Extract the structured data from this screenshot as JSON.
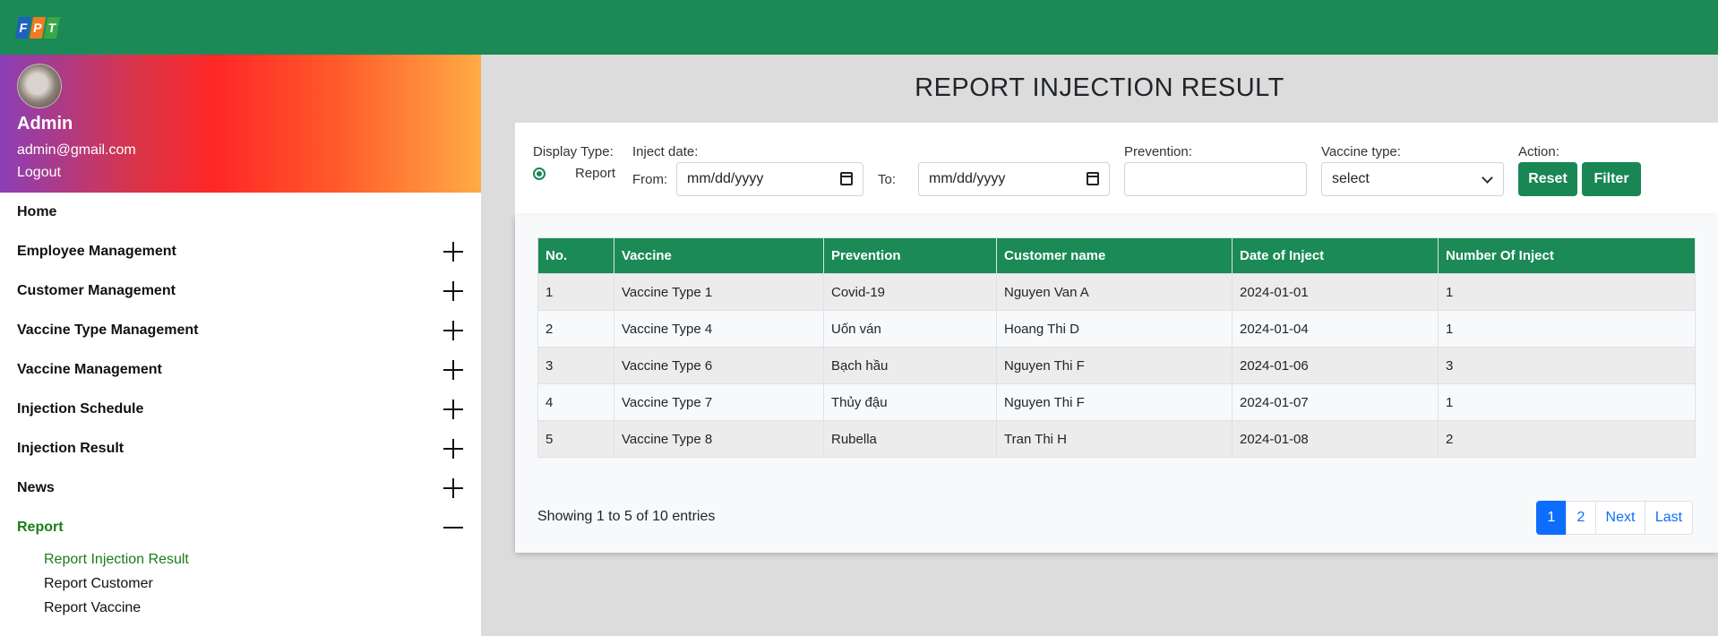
{
  "logo": {
    "letters": [
      "F",
      "P",
      "T"
    ]
  },
  "profile": {
    "name": "Admin",
    "email": "admin@gmail.com",
    "logout": "Logout"
  },
  "menu": {
    "home": "Home",
    "items": [
      {
        "label": "Employee Management",
        "toggle": "plus"
      },
      {
        "label": "Customer Management",
        "toggle": "plus"
      },
      {
        "label": "Vaccine Type Management",
        "toggle": "plus"
      },
      {
        "label": "Vaccine Management",
        "toggle": "plus"
      },
      {
        "label": "Injection Schedule",
        "toggle": "plus"
      },
      {
        "label": "Injection Result",
        "toggle": "plus"
      },
      {
        "label": "News",
        "toggle": "plus"
      },
      {
        "label": "Report",
        "toggle": "minus"
      }
    ],
    "report_sub": [
      "Report Injection Result",
      "Report Customer",
      "Report Vaccine"
    ]
  },
  "page_title": "REPORT INJECTION RESULT",
  "filters": {
    "display_type_label": "Display Type:",
    "display_type_option": "Report",
    "inject_date_label": "Inject date:",
    "from_label": "From:",
    "to_label": "To:",
    "from_placeholder": "mm/dd/yyyy",
    "to_placeholder": "mm/dd/yyyy",
    "prevention_label": "Prevention:",
    "prevention_value": "",
    "vaccine_type_label": "Vaccine type:",
    "vaccine_type_selected": "select",
    "action_label": "Action:",
    "reset": "Reset",
    "filter": "Filter"
  },
  "table": {
    "headers": [
      "No.",
      "Vaccine",
      "Prevention",
      "Customer name",
      "Date of Inject",
      "Number Of Inject"
    ],
    "rows": [
      [
        "1",
        "Vaccine Type 1",
        "Covid-19",
        "Nguyen Van A",
        "2024-01-01",
        "1"
      ],
      [
        "2",
        "Vaccine Type 4",
        "Uốn ván",
        "Hoang Thi D",
        "2024-01-04",
        "1"
      ],
      [
        "3",
        "Vaccine Type 6",
        "Bạch hầu",
        "Nguyen Thi F",
        "2024-01-06",
        "3"
      ],
      [
        "4",
        "Vaccine Type 7",
        "Thủy đậu",
        "Nguyen Thi F",
        "2024-01-07",
        "1"
      ],
      [
        "5",
        "Vaccine Type 8",
        "Rubella",
        "Tran Thi H",
        "2024-01-08",
        "2"
      ]
    ]
  },
  "footer": {
    "showing": "Showing 1 to 5 of 10 entries",
    "pages": [
      "1",
      "2",
      "Next",
      "Last"
    ],
    "current_page": "1"
  },
  "colors": {
    "primary_green": "#1b8a57",
    "active_menu": "#1a7d1a",
    "pagination_blue": "#0d6efd"
  }
}
